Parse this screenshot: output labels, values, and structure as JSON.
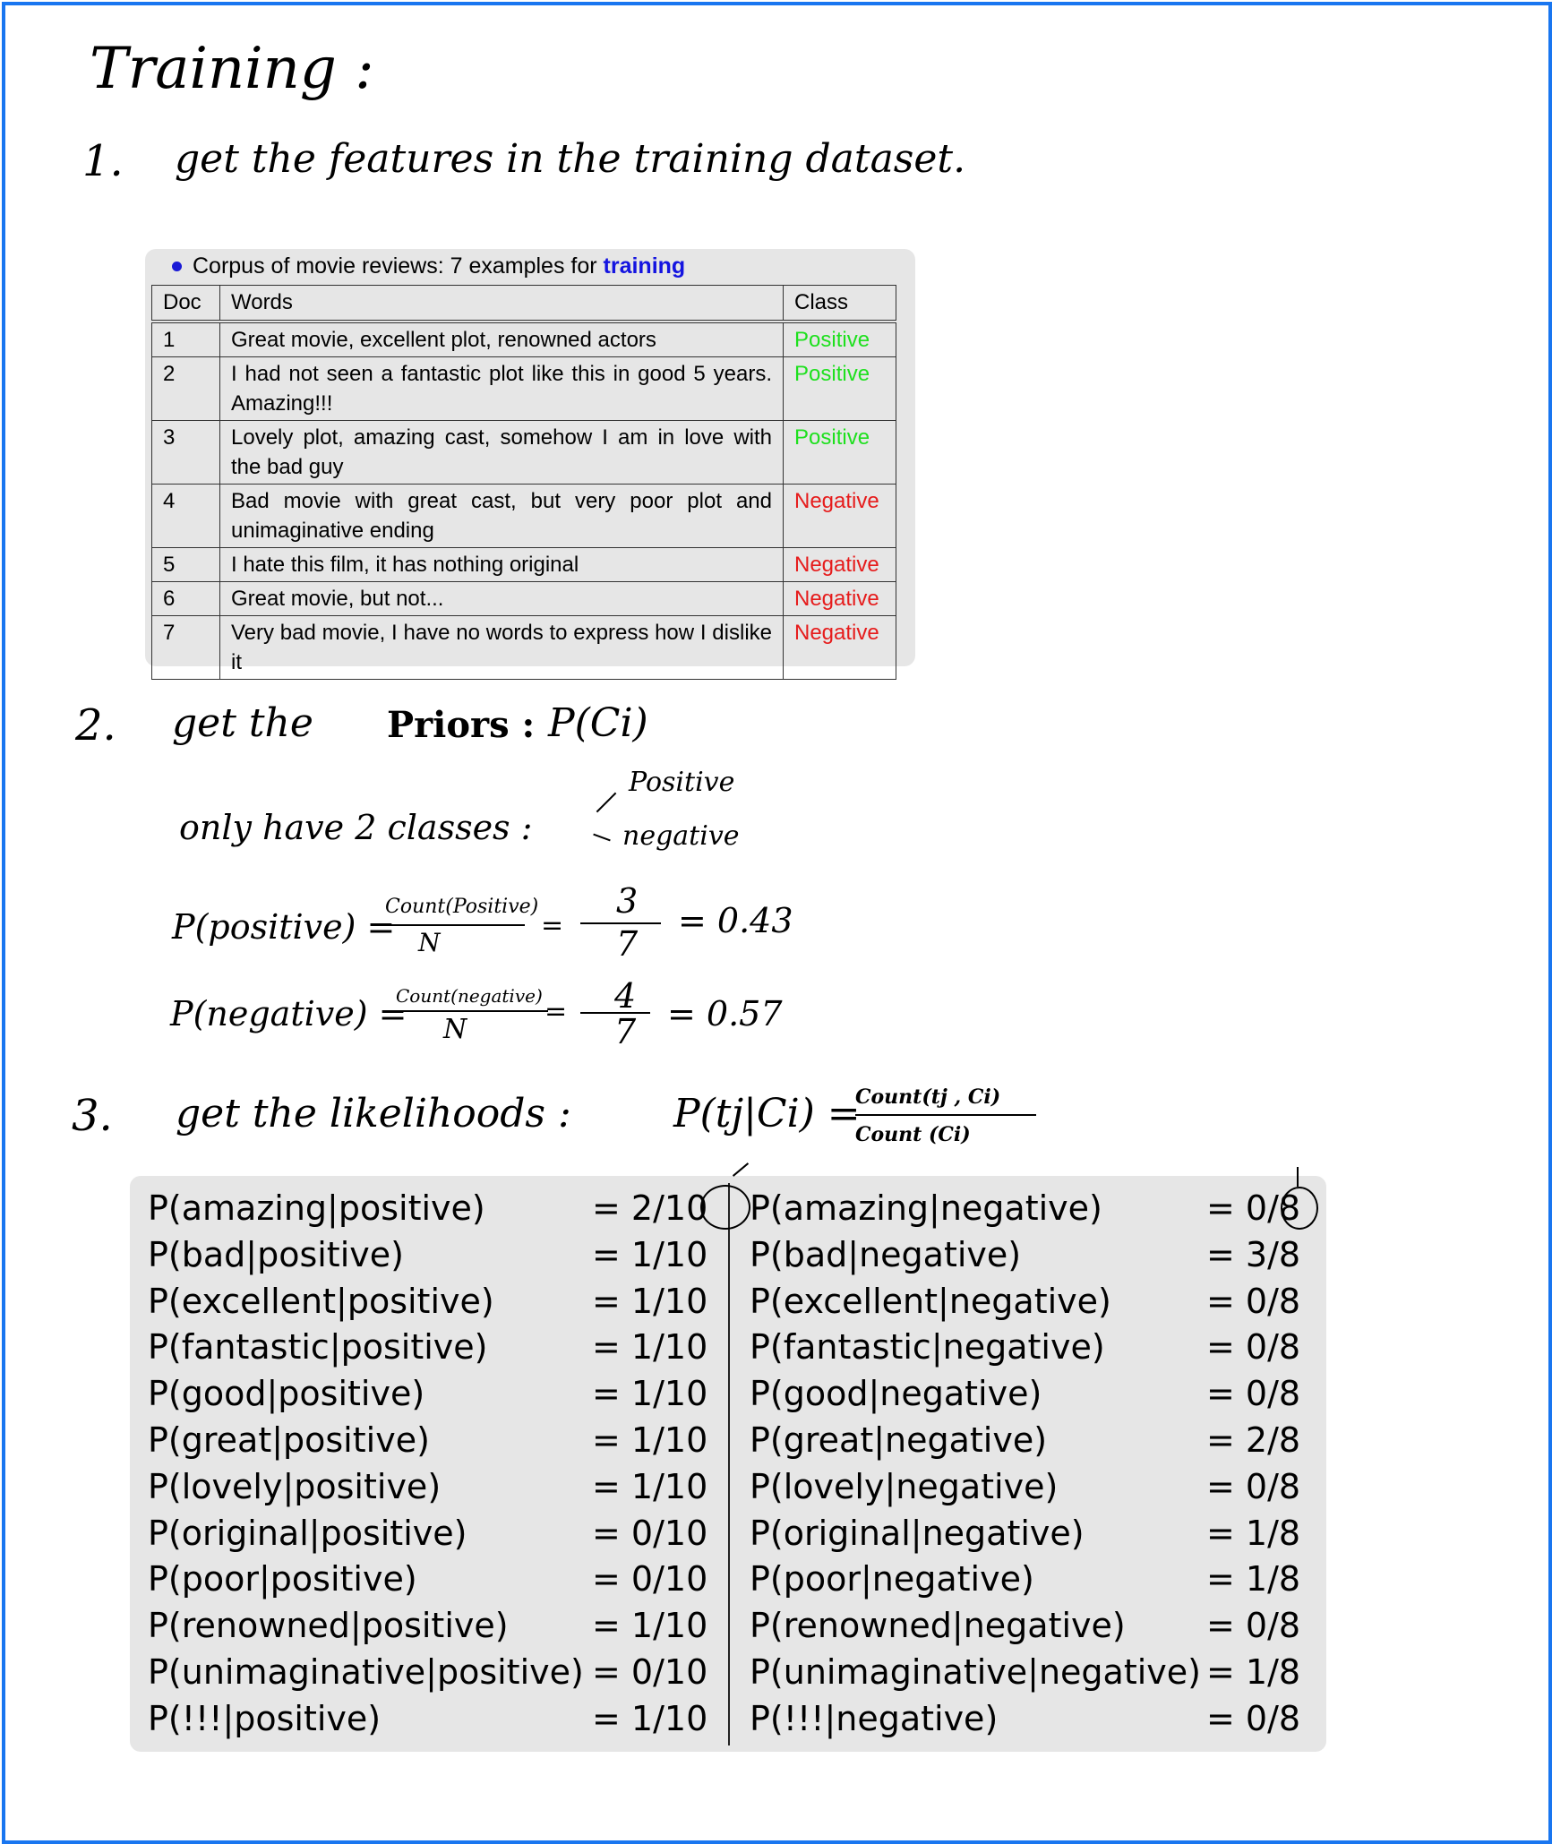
{
  "title": "Training :",
  "step1": {
    "num": "1.",
    "text": "get the features in the training dataset."
  },
  "corpus": {
    "caption_prefix": "Corpus of movie reviews: 7 examples for",
    "caption_highlight": "training",
    "headers": [
      "Doc",
      "Words",
      "Class"
    ],
    "rows": [
      {
        "doc": "1",
        "words": "Great movie, excellent plot, renowned actors",
        "cls": "Positive"
      },
      {
        "doc": "2",
        "words": "I had not seen a fantastic plot like this in good 5 years. Amazing!!!",
        "cls": "Positive"
      },
      {
        "doc": "3",
        "words": "Lovely plot, amazing cast, somehow I am in love with the bad guy",
        "cls": "Positive"
      },
      {
        "doc": "4",
        "words": "Bad movie with great cast, but very poor plot and unimaginative ending",
        "cls": "Negative"
      },
      {
        "doc": "5",
        "words": "I hate this film, it has nothing original",
        "cls": "Negative"
      },
      {
        "doc": "6",
        "words": "Great movie, but not...",
        "cls": "Negative"
      },
      {
        "doc": "7",
        "words": "Very bad movie, I have no words to express how I dislike it",
        "cls": "Negative"
      }
    ]
  },
  "step2": {
    "num": "2.",
    "text": "get the",
    "bold": "Priors :",
    "formula": "P(Ci)",
    "classes_text": "only have 2 classes :",
    "class_pos": "Positive",
    "class_neg": "negative",
    "p_pos_lhs": "P(positive) =",
    "p_pos_num": "Count(Positive)",
    "p_pos_den": "N",
    "p_pos_frac_num": "3",
    "p_pos_frac_den": "7",
    "p_pos_result": "= 0.43",
    "p_neg_lhs": "P(negative) =",
    "p_neg_num": "Count(negative)",
    "p_neg_den": "N",
    "p_neg_frac_num": "4",
    "p_neg_frac_den": "7",
    "p_neg_result": "= 0.57",
    "eq": "="
  },
  "step3": {
    "num": "3.",
    "text": "get the likelihoods :",
    "formula_lhs": "P(tj|Ci) =",
    "formula_num": "Count(tj , Ci)",
    "formula_den": "Count (Ci)"
  },
  "likelihoods": {
    "positive": [
      {
        "term": "P(amazing|positive)",
        "val": "= 2/10"
      },
      {
        "term": "P(bad|positive)",
        "val": "= 1/10"
      },
      {
        "term": "P(excellent|positive)",
        "val": "= 1/10"
      },
      {
        "term": "P(fantastic|positive)",
        "val": "= 1/10"
      },
      {
        "term": "P(good|positive)",
        "val": "= 1/10"
      },
      {
        "term": "P(great|positive)",
        "val": "= 1/10"
      },
      {
        "term": "P(lovely|positive)",
        "val": "= 1/10"
      },
      {
        "term": "P(original|positive)",
        "val": "= 0/10"
      },
      {
        "term": "P(poor|positive)",
        "val": "= 0/10"
      },
      {
        "term": "P(renowned|positive)",
        "val": "= 1/10"
      },
      {
        "term": "P(unimaginative|positive)",
        "val": "= 0/10"
      },
      {
        "term": "P(!!!|positive)",
        "val": "= 1/10"
      }
    ],
    "negative": [
      {
        "term": "P(amazing|negative)",
        "val": "= 0/8"
      },
      {
        "term": "P(bad|negative)",
        "val": "= 3/8"
      },
      {
        "term": "P(excellent|negative)",
        "val": "= 0/8"
      },
      {
        "term": "P(fantastic|negative)",
        "val": "= 0/8"
      },
      {
        "term": "P(good|negative)",
        "val": "= 0/8"
      },
      {
        "term": "P(great|negative)",
        "val": "= 2/8"
      },
      {
        "term": "P(lovely|negative)",
        "val": "= 0/8"
      },
      {
        "term": "P(original|negative)",
        "val": "= 1/8"
      },
      {
        "term": "P(poor|negative)",
        "val": "= 1/8"
      },
      {
        "term": "P(renowned|negative)",
        "val": "= 0/8"
      },
      {
        "term": "P(unimaginative|negative)",
        "val": "= 1/8"
      },
      {
        "term": "P(!!!|negative)",
        "val": "= 0/8"
      }
    ]
  }
}
